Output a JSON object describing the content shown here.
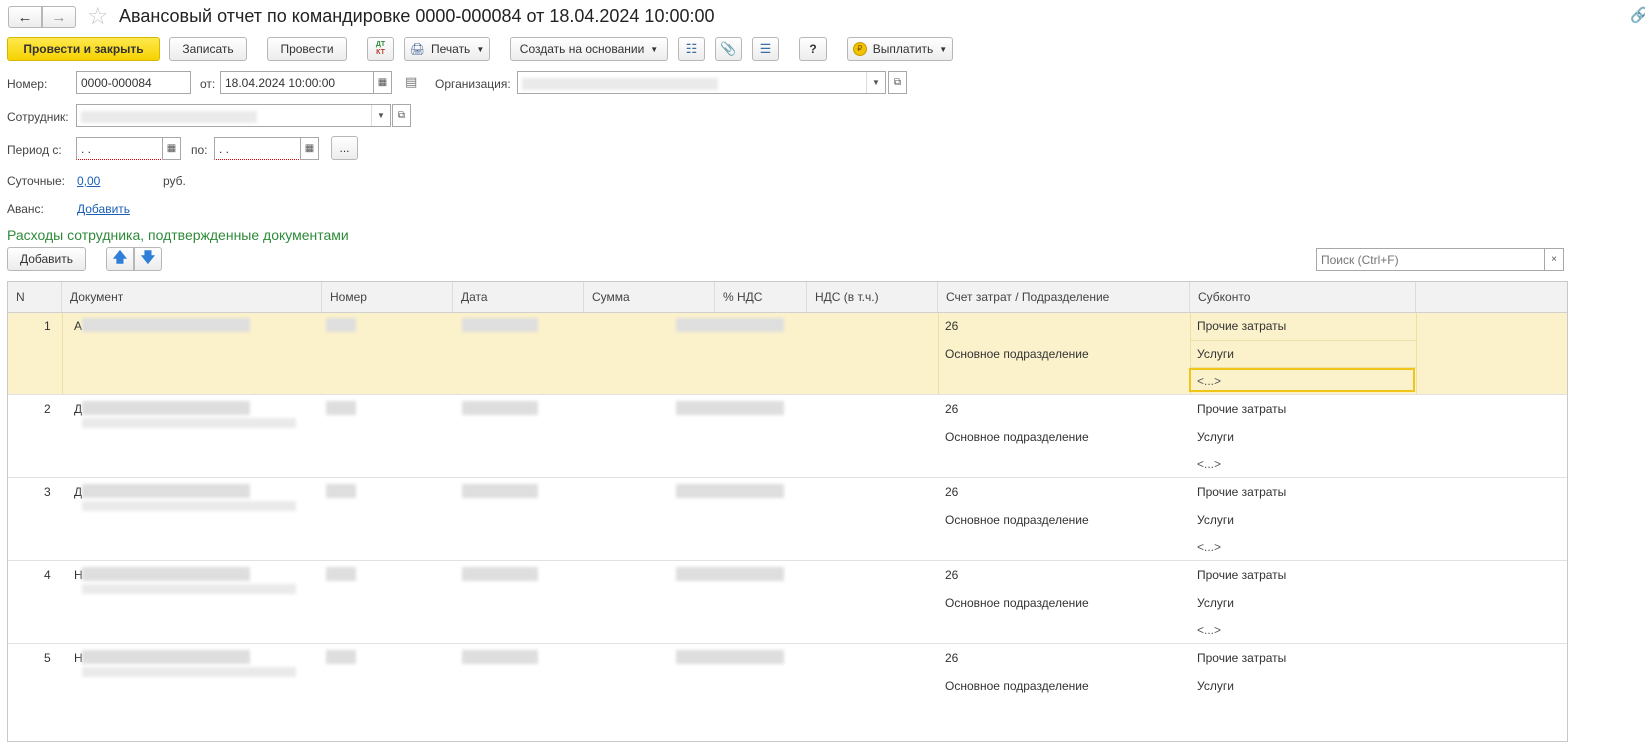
{
  "title": "Авансовый отчет по командировке 0000-000084 от 18.04.2024 10:00:00",
  "toolbar": {
    "post_close": "Провести и закрыть",
    "save": "Записать",
    "post": "Провести",
    "dtkt_top": "ДТ",
    "dtkt_bottom": "КТ",
    "print": "Печать",
    "create_based": "Создать на основании",
    "help": "?",
    "pay": "Выплатить"
  },
  "form": {
    "number_label": "Номер:",
    "number_value": "0000-000084",
    "date_label": "от:",
    "date_value": "18.04.2024 10:00:00",
    "org_label": "Организация:",
    "employee_label": "Сотрудник:",
    "period_from_label": "Период с:",
    "period_from_value": " .  .",
    "period_to_label": "по:",
    "period_to_value": " .  .",
    "period_more": "...",
    "per_diem_label": "Суточные:",
    "per_diem_value": "0,00",
    "per_diem_currency": "руб.",
    "advance_label": "Аванс:",
    "advance_link": "Добавить"
  },
  "section_title": "Расходы сотрудника, подтвержденные документами",
  "table_toolbar": {
    "add": "Добавить",
    "search_placeholder": "Поиск (Ctrl+F)",
    "search_clear": "×"
  },
  "table": {
    "columns": [
      "N",
      "Документ",
      "Номер",
      "Дата",
      "Сумма",
      "% НДС",
      "НДС (в т.ч.)",
      "Счет затрат / Подразделение",
      "Субконто"
    ],
    "rows": [
      {
        "n": "1",
        "doc_initial": "А",
        "account": "26",
        "division": "Основное подразделение",
        "sub1": "Прочие затраты",
        "sub2": "Услуги",
        "sub3": "<...>"
      },
      {
        "n": "2",
        "doc_initial": "Д",
        "account": "26",
        "division": "Основное подразделение",
        "sub1": "Прочие затраты",
        "sub2": "Услуги",
        "sub3": "<...>"
      },
      {
        "n": "3",
        "doc_initial": "Д",
        "account": "26",
        "division": "Основное подразделение",
        "sub1": "Прочие затраты",
        "sub2": "Услуги",
        "sub3": "<...>"
      },
      {
        "n": "4",
        "doc_initial": "Н",
        "account": "26",
        "division": "Основное подразделение",
        "sub1": "Прочие затраты",
        "sub2": "Услуги",
        "sub3": "<...>"
      },
      {
        "n": "5",
        "doc_initial": "Н",
        "account": "26",
        "division": "Основное подразделение",
        "sub1": "Прочие затраты",
        "sub2": "Услуги",
        "sub3": ""
      }
    ]
  },
  "colors": {
    "accent_yellow": "#f6d200",
    "selected_row": "#fbf2cb",
    "section_green": "#2e8b3a",
    "link_blue": "#1a5fb4"
  }
}
